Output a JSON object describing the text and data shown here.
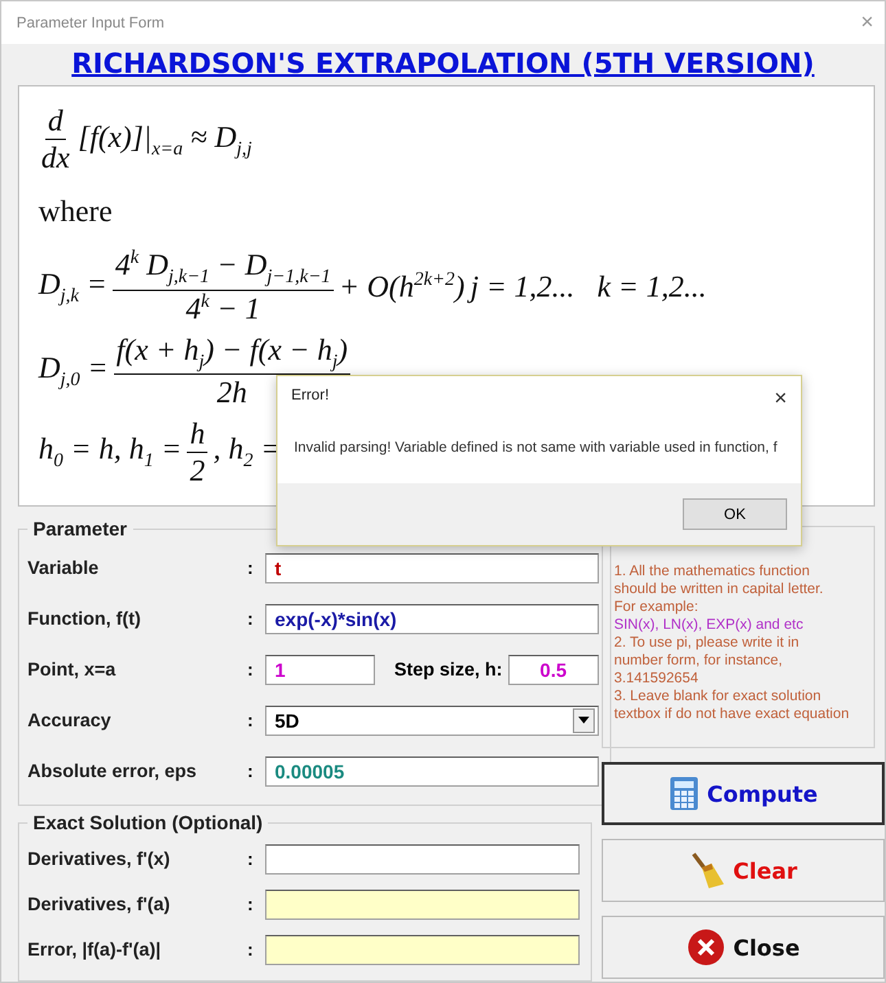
{
  "window": {
    "title": "Parameter Input Form",
    "close": "×"
  },
  "heading": "RICHARDSON'S EXTRAPOLATION (5TH VERSION)",
  "formulas": [
    {
      "parts": [
        {
          "kind": "frac",
          "num": "d",
          "den": "dx"
        },
        {
          "kind": "text",
          "text": "[f(x)]|$_{x=a}$ ≈ D$_{j,j}$"
        }
      ]
    },
    {
      "parts": [
        {
          "kind": "word",
          "text": "where"
        }
      ]
    },
    {
      "parts": [
        {
          "kind": "text",
          "text": "D$_{j,k}$ ="
        },
        {
          "kind": "frac",
          "num": "4$^{k}$ D$_{j,k−1}$ − D$_{j−1,k−1}$",
          "den": "4$^{k}$ − 1"
        },
        {
          "kind": "text",
          "text": "+ O(h$^{2k+2}$)"
        },
        {
          "kind": "text",
          "text": "j = 1,2...   k = 1,2..."
        }
      ]
    },
    {
      "parts": [
        {
          "kind": "text",
          "text": "D$_{j,0}$ ="
        },
        {
          "kind": "frac",
          "num": "f(x + h$_{j}$) − f(x − h$_{j}$)",
          "den": "2h"
        }
      ]
    },
    {
      "parts": [
        {
          "kind": "text",
          "text": "h$_{0}$ = h, h$_{1}$ ="
        },
        {
          "kind": "frac",
          "num": "h",
          "den": "2"
        },
        {
          "kind": "text",
          "text": ", h$_{2}$ ="
        }
      ]
    }
  ],
  "dialog": {
    "title": "Error!",
    "close": "×",
    "message": "Invalid parsing! Variable defined is not same with variable used in function, f",
    "button": "OK"
  },
  "parameter": {
    "legend": "Parameter",
    "rows": [
      {
        "label": "Variable",
        "fields": [
          {
            "kind": "text",
            "value": "t",
            "color": "#c00000"
          }
        ]
      },
      {
        "label": "Function, f(t)",
        "fields": [
          {
            "kind": "text",
            "value": "exp(-x)*sin(x)",
            "color": "#1a1aa6"
          }
        ]
      },
      {
        "label": "Point, x=a",
        "fields": [
          {
            "kind": "short",
            "value": "1",
            "color": "#cc00cc"
          },
          {
            "kind": "labelled",
            "label": "Step size, h:",
            "value": "0.5",
            "color": "#cc00cc"
          }
        ]
      },
      {
        "label": "Accuracy",
        "fields": [
          {
            "kind": "select",
            "value": "5D",
            "color": "#000000"
          }
        ]
      },
      {
        "label": "Absolute error, eps",
        "fields": [
          {
            "kind": "text",
            "value": "0.00005",
            "color": "#1a8a80"
          }
        ]
      }
    ]
  },
  "exact": {
    "legend": "Exact Solution (Optional)",
    "rows": [
      {
        "label": "Derivatives, f'(x)",
        "readonly": false
      },
      {
        "label": "Derivatives, f'(a)",
        "readonly": true
      },
      {
        "label": "Error, |f(a)-f'(a)|",
        "readonly": true
      }
    ]
  },
  "colon": ":",
  "instructions": [
    {
      "kind": "note",
      "text": "1. All the mathematics function"
    },
    {
      "kind": "note",
      "text": "should be written in capital letter."
    },
    {
      "kind": "note",
      "text": "For example:"
    },
    {
      "kind": "example",
      "text": "SIN(x), LN(x), EXP(x) and etc"
    },
    {
      "kind": "note",
      "text": "2. To use pi, please write it in"
    },
    {
      "kind": "note",
      "text": "number form, for instance,"
    },
    {
      "kind": "note",
      "text": "3.141592654"
    },
    {
      "kind": "note",
      "text": "3. Leave blank for exact solution"
    },
    {
      "kind": "note",
      "text": "textbox if do not have exact equation"
    }
  ],
  "buttons": [
    {
      "kind": "compute",
      "label": "Compute",
      "default": true
    },
    {
      "kind": "clear",
      "label": "Clear",
      "default": false
    },
    {
      "kind": "close",
      "label": "Close",
      "default": false
    }
  ]
}
